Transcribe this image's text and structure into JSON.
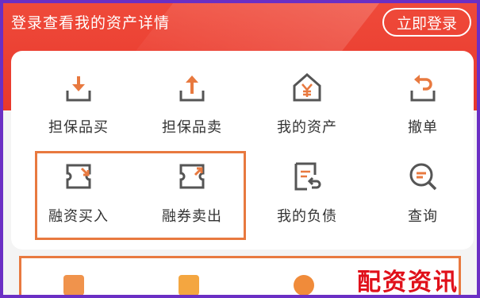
{
  "banner": {
    "prompt": "登录查看我的资产详情",
    "login_button": "立即登录"
  },
  "menu": [
    {
      "label": "担保品买",
      "icon": "download-tray-icon"
    },
    {
      "label": "担保品卖",
      "icon": "upload-tray-icon"
    },
    {
      "label": "我的资产",
      "icon": "house-yen-icon"
    },
    {
      "label": "撤单",
      "icon": "undo-tray-icon"
    },
    {
      "label": "融资买入",
      "icon": "ticket-arrow-in-icon"
    },
    {
      "label": "融券卖出",
      "icon": "ticket-arrow-out-icon"
    },
    {
      "label": "我的负债",
      "icon": "document-return-icon"
    },
    {
      "label": "查询",
      "icon": "search-icon"
    }
  ],
  "watermark": "配资资讯",
  "colors": {
    "brand": "#e8382c",
    "icon": "#555555",
    "accent": "#e8793f"
  }
}
